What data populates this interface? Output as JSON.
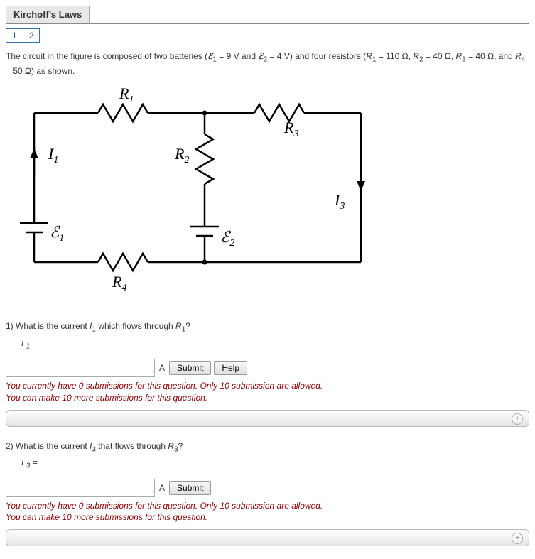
{
  "header": {
    "title": "Kirchoff's Laws",
    "tabs": [
      "1",
      "2"
    ],
    "active_tab": 0
  },
  "problem": {
    "intro_pre": "The circuit in the figure is composed of two batteries (",
    "e1_label": "ℰ",
    "e1_sub": "1",
    "e1_val": " = 9 V and ",
    "e2_label": "ℰ",
    "e2_sub": "2",
    "e2_val": " = 4 V) and four resistors (",
    "r1": "R",
    "r1_sub": "1",
    "r1_val": " = 110 Ω, ",
    "r2": "R",
    "r2_sub": "2",
    "r2_val": " = 40 Ω, ",
    "r3": "R",
    "r3_sub": "3",
    "r3_val": " = 40 Ω, and ",
    "r4": "R",
    "r4_sub": "4",
    "r4_val": " = 50 Ω) as shown."
  },
  "figure": {
    "labels": {
      "R1": "R",
      "R1_sub": "1",
      "R2": "R",
      "R2_sub": "2",
      "R3": "R",
      "R3_sub": "3",
      "R4": "R",
      "R4_sub": "4",
      "I1": "I",
      "I1_sub": "1",
      "I3": "I",
      "I3_sub": "3",
      "E1": "ℰ",
      "E1_sub": "1",
      "E2": "ℰ",
      "E2_sub": "2"
    }
  },
  "q1": {
    "prompt_pre": "1) What is the current ",
    "prompt_var": "I",
    "prompt_var_sub": "1",
    "prompt_mid": " which flows through ",
    "prompt_r": "R",
    "prompt_r_sub": "1",
    "prompt_post": "?",
    "ans_label": "I ",
    "ans_sub": "1",
    "ans_eq": " = ",
    "unit": "A",
    "submit": "Submit",
    "help": "Help",
    "fb1": "You currently have 0 submissions for this question. Only 10 submission are allowed.",
    "fb2": "You can make 10 more submissions for this question."
  },
  "q2": {
    "prompt_pre": "2) What is the current ",
    "prompt_var": "I",
    "prompt_var_sub": "3",
    "prompt_mid": " that flows through ",
    "prompt_r": "R",
    "prompt_r_sub": "3",
    "prompt_post": "?",
    "ans_label": "I ",
    "ans_sub": "3",
    "ans_eq": " = ",
    "unit": "A",
    "submit": "Submit",
    "fb1": "You currently have 0 submissions for this question. Only 10 submission are allowed.",
    "fb2": "You can make 10 more submissions for this question."
  },
  "plus": "+"
}
